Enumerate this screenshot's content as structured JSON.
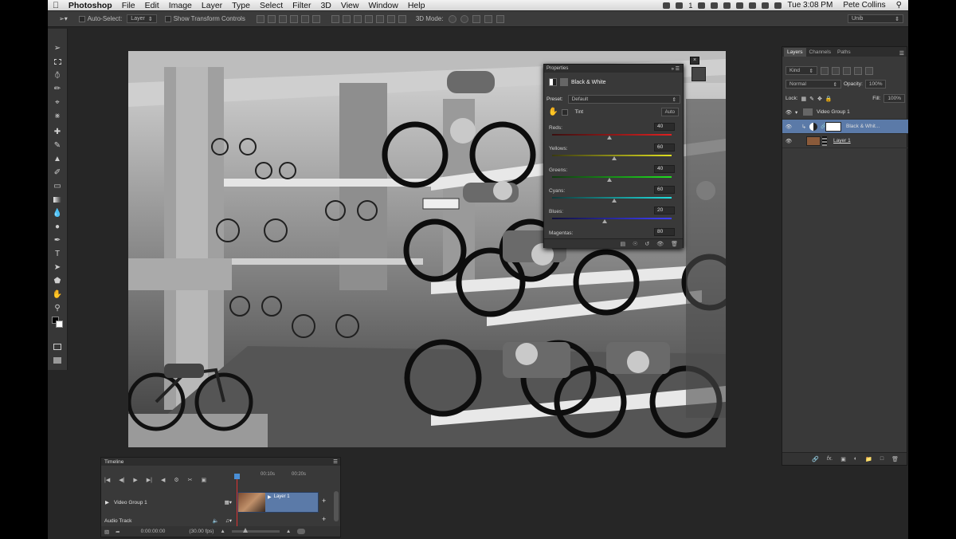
{
  "menubar": {
    "app_name": "Photoshop",
    "items": [
      "File",
      "Edit",
      "Image",
      "Layer",
      "Type",
      "Select",
      "Filter",
      "3D",
      "View",
      "Window",
      "Help"
    ],
    "clock": "Tue 3:08 PM",
    "user": "Pete Collins",
    "badge": "1"
  },
  "options_bar": {
    "auto_select_label": "Auto-Select:",
    "auto_select_value": "Layer",
    "show_transform_label": "Show Transform Controls",
    "mode_3d_label": "3D Mode:",
    "workspace": "Unib"
  },
  "properties": {
    "title": "Properties",
    "adjustment_name": "Black & White",
    "preset_label": "Preset:",
    "preset_value": "Default",
    "tint_label": "Tint",
    "auto_label": "Auto",
    "sliders": [
      {
        "label": "Reds:",
        "value": "40",
        "level": 40
      },
      {
        "label": "Yellows:",
        "value": "60",
        "level": 60
      },
      {
        "label": "Greens:",
        "value": "40",
        "level": 40
      },
      {
        "label": "Cyans:",
        "value": "60",
        "level": 60
      },
      {
        "label": "Blues:",
        "value": "20",
        "level": 20
      },
      {
        "label": "Magentas:",
        "value": "80",
        "level": 80
      }
    ]
  },
  "layers_panel": {
    "tabs": [
      "Layers",
      "Channels",
      "Paths"
    ],
    "kind_label": "Kind",
    "blend_mode": "Normal",
    "opacity_label": "Opacity:",
    "opacity_value": "100%",
    "lock_label": "Lock:",
    "fill_label": "Fill:",
    "fill_value": "100%",
    "layers": [
      {
        "name": "Video Group 1"
      },
      {
        "name": "Black & Whit..."
      },
      {
        "name": "Layer 1"
      }
    ]
  },
  "timeline": {
    "title": "Timeline",
    "time_markers": [
      "00:10s",
      "00:20s"
    ],
    "track_name": "Video Group 1",
    "clip_name": "Layer 1",
    "audio_track": "Audio Track",
    "timecode": "0:00:00:00",
    "fps": "(30.00 fps)"
  }
}
